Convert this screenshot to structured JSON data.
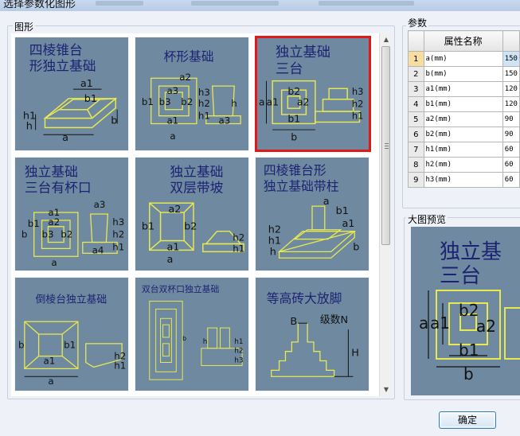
{
  "window": {
    "title": "选择参数化图形"
  },
  "gallery": {
    "label": "图形",
    "thumbnails": [
      {
        "title_line1": "四棱锥台",
        "title_line2": "形独立基础",
        "labels": [
          "a1",
          "b1",
          "h1",
          "h",
          "a",
          "b"
        ],
        "selected": false
      },
      {
        "title_line1": "杯形基础",
        "title_line2": "",
        "labels": [
          "a2",
          "a3",
          "b1",
          "b3",
          "b2",
          "h3",
          "h2",
          "h1",
          "h",
          "a1",
          "a3",
          "a"
        ],
        "selected": false
      },
      {
        "title_line1": "独立基础",
        "title_line2": "三台",
        "labels": [
          "b2",
          "a2",
          "a1",
          "b1",
          "a",
          "b",
          "h3",
          "h2",
          "h1"
        ],
        "selected": true
      },
      {
        "title_line1": "独立基础",
        "title_line2": "三台有杯口",
        "labels": [
          "a1",
          "a2",
          "a3",
          "b1",
          "b3",
          "b2",
          "a",
          "b",
          "a4",
          "h3",
          "h2",
          "h1"
        ],
        "selected": false
      },
      {
        "title_line1": "独立基础",
        "title_line2": "双层带坡",
        "labels": [
          "a2",
          "b1",
          "b2",
          "a1",
          "a",
          "h2",
          "h1"
        ],
        "selected": false
      },
      {
        "title_line1": "四棱锥台形",
        "title_line2": "独立基础带柱",
        "labels": [
          "a",
          "b1",
          "a1",
          "h2",
          "h1",
          "h",
          "b"
        ],
        "selected": false
      },
      {
        "title_line1": "倒棱台独立基础",
        "title_line2": "",
        "labels": [
          "b1",
          "a1",
          "b",
          "a",
          "h2",
          "h1"
        ],
        "selected": false
      },
      {
        "title_line1": "双台双杯口独立基础",
        "title_line2": "",
        "labels": [
          "b",
          "h",
          "h1",
          "h2",
          "h3"
        ],
        "selected": false
      },
      {
        "title_line1": "等高砖大放脚",
        "title_line2": "",
        "labels": [
          "B",
          "级数N",
          "H"
        ],
        "selected": false
      }
    ]
  },
  "params": {
    "label": "参数",
    "header": "属性名称",
    "rows": [
      {
        "num": "1",
        "name": "a(mm)",
        "value": "150"
      },
      {
        "num": "2",
        "name": "b(mm)",
        "value": "150"
      },
      {
        "num": "3",
        "name": "a1(mm)",
        "value": "120"
      },
      {
        "num": "4",
        "name": "b1(mm)",
        "value": "120"
      },
      {
        "num": "5",
        "name": "a2(mm)",
        "value": "90"
      },
      {
        "num": "6",
        "name": "b2(mm)",
        "value": "90"
      },
      {
        "num": "7",
        "name": "h1(mm)",
        "value": "60"
      },
      {
        "num": "8",
        "name": "h2(mm)",
        "value": "60"
      },
      {
        "num": "9",
        "name": "h3(mm)",
        "value": "60"
      }
    ]
  },
  "preview": {
    "label": "大图预览",
    "title_line1": "独立基",
    "title_line2": "三台",
    "labels": [
      "a",
      "a1",
      "b2",
      "a2",
      "b1",
      "b"
    ]
  },
  "buttons": {
    "ok": "确定"
  },
  "colors": {
    "thumb_bg": "#6f8aa0",
    "drawing_line": "#e8e850",
    "title_text": "#1d2373",
    "selection": "#e01818"
  }
}
